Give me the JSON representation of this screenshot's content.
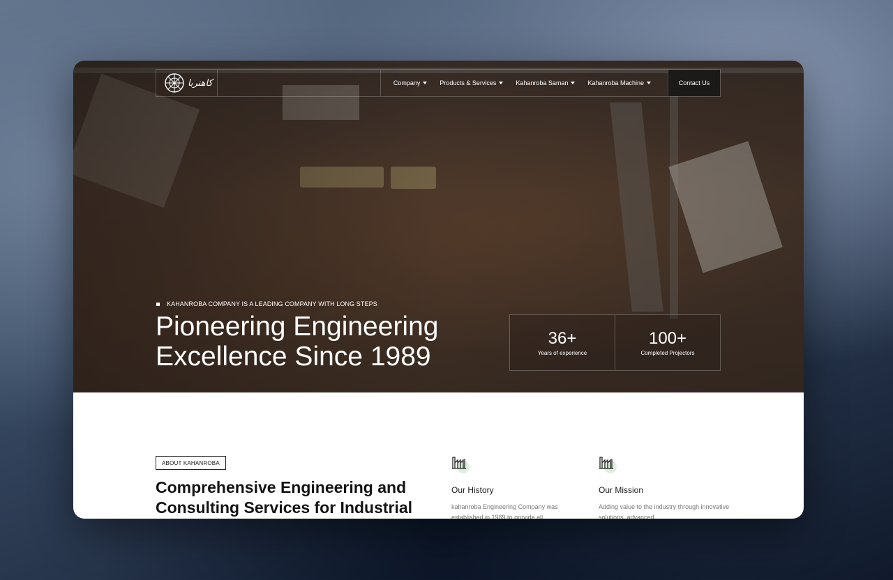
{
  "brand": {
    "logo_text": "کاهنربا"
  },
  "nav": {
    "items": [
      {
        "label": "Company"
      },
      {
        "label": "Products & Services"
      },
      {
        "label": "Kahanroba Saman"
      },
      {
        "label": "Kahanroba Machine"
      }
    ],
    "contact_label": "Contact Us"
  },
  "hero": {
    "tagline": "KAHANROBA COMPANY IS A LEADING COMPANY WITH LONG STEPS",
    "title": "Pioneering Engineering Excellence Since 1989",
    "stats": [
      {
        "value": "36+",
        "label": "Years of experience"
      },
      {
        "value": "100+",
        "label": "Completed Projectors"
      }
    ]
  },
  "about": {
    "tag": "ABOUT KAHANROBA",
    "title": "Comprehensive Engineering and Consulting Services for Industrial",
    "cards": [
      {
        "icon": "factory-icon",
        "title": "Our History",
        "text": "kahanroba Engineering Company was established in 1989 to provide all"
      },
      {
        "icon": "factory-icon",
        "title": "Our Mission",
        "text": "Adding value to the industry through innovative solutions, advanced"
      }
    ]
  },
  "colors": {
    "accent_soft": "#dfeede",
    "dark_button": "#1b1a18"
  }
}
